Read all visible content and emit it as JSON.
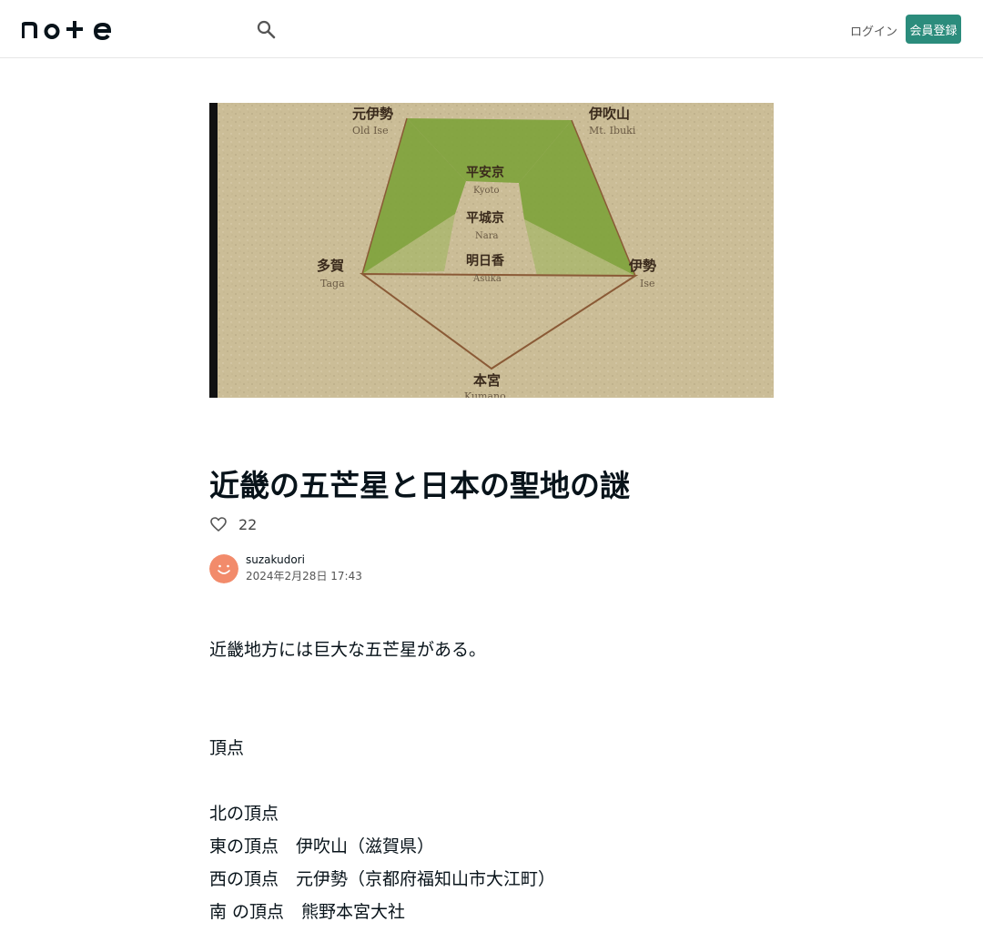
{
  "header": {
    "logo_text": "note",
    "login_label": "ログイン",
    "signup_label": "会員登録"
  },
  "hero": {
    "labels": [
      {
        "jp": "元伊勢",
        "en": "Old Ise"
      },
      {
        "jp": "伊吹山",
        "en": "Mt. Ibuki"
      },
      {
        "jp": "平安京",
        "en": "Kyoto"
      },
      {
        "jp": "平城京",
        "en": "Nara"
      },
      {
        "jp": "明日香",
        "en": "Asuka"
      },
      {
        "jp": "多賀",
        "en": "Taga"
      },
      {
        "jp": "伊勢",
        "en": "Ise"
      },
      {
        "jp": "本宮",
        "en": "Kumano"
      }
    ]
  },
  "article": {
    "title": "近畿の五芒星と日本の聖地の謎",
    "like_count": "22",
    "author": "suzakudori",
    "date": "2024年2月28日 17:43",
    "paragraphs": [
      "近畿地方には巨大な五芒星がある。",
      "",
      "",
      "頂点",
      "",
      "北の頂点",
      "東の頂点　伊吹山（滋賀県）",
      "西の頂点　元伊勢（京都府福知山市大江町）",
      "南 の頂点　熊野本宮大社"
    ]
  },
  "colors": {
    "accent": "#2b8c7c",
    "pentagram_green": "#7da23a",
    "parchment": "#cdbf9a",
    "avatar": "#f28b6b"
  }
}
